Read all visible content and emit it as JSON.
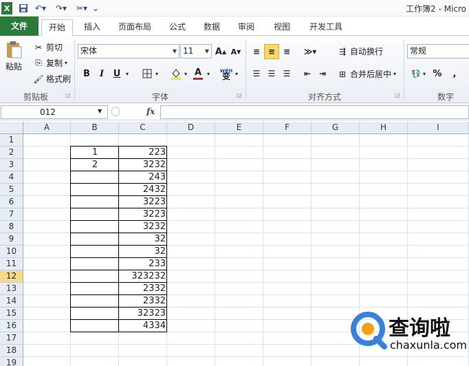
{
  "window": {
    "title": "工作簿2 - Micro"
  },
  "quick_access": {
    "icons": [
      "excel-logo-icon",
      "save-icon",
      "undo-icon",
      "redo-icon",
      "customize-icon"
    ]
  },
  "tabs": [
    {
      "label": "文件"
    },
    {
      "label": "开始"
    },
    {
      "label": "插入"
    },
    {
      "label": "页面布局"
    },
    {
      "label": "公式"
    },
    {
      "label": "数据"
    },
    {
      "label": "审阅"
    },
    {
      "label": "视图"
    },
    {
      "label": "开发工具"
    }
  ],
  "ribbon": {
    "clipboard": {
      "label": "剪贴板",
      "paste": "粘贴",
      "cut": "剪切",
      "copy": "复制",
      "format_painter": "格式刷"
    },
    "font": {
      "label": "字体",
      "name": "宋体",
      "size": "11",
      "grow": "A",
      "shrink": "A",
      "bold": "B",
      "italic": "I",
      "underline": "U",
      "font_color_glyph": "A",
      "phonetic_glyph": "wén"
    },
    "alignment": {
      "label": "对齐方式",
      "wrap": "自动换行",
      "merge": "合并后居中"
    },
    "number": {
      "label": "数字",
      "format": "常规",
      "percent": "%",
      "comma": ","
    },
    "accent_file": "#2a7a3a",
    "accent_selected_row": "#f5d88a"
  },
  "formula_bar": {
    "name_box": "012",
    "fx": "fx",
    "content": ""
  },
  "sheet": {
    "columns": [
      "A",
      "B",
      "C",
      "D",
      "E",
      "F",
      "G",
      "H",
      "I"
    ],
    "rows": [
      "1",
      "2",
      "3",
      "4",
      "5",
      "6",
      "7",
      "8",
      "9",
      "10",
      "11",
      "12",
      "13",
      "14",
      "15",
      "16",
      "17",
      "18",
      "19"
    ],
    "selected_row": "12",
    "cells": {
      "b": [
        "",
        "1",
        "2",
        "",
        "",
        "",
        "",
        "",
        "",
        "",
        "",
        "",
        "",
        "",
        "",
        "",
        "",
        "",
        ""
      ],
      "c": [
        "",
        "223",
        "3232",
        "243",
        "2432",
        "3223",
        "3223",
        "3232",
        "32",
        "32",
        "233",
        "323232",
        "2332",
        "2332",
        "32323",
        "4334",
        "",
        "",
        ""
      ]
    }
  },
  "watermark": {
    "brand": "查询啦",
    "domain": "chaxunla.com"
  }
}
